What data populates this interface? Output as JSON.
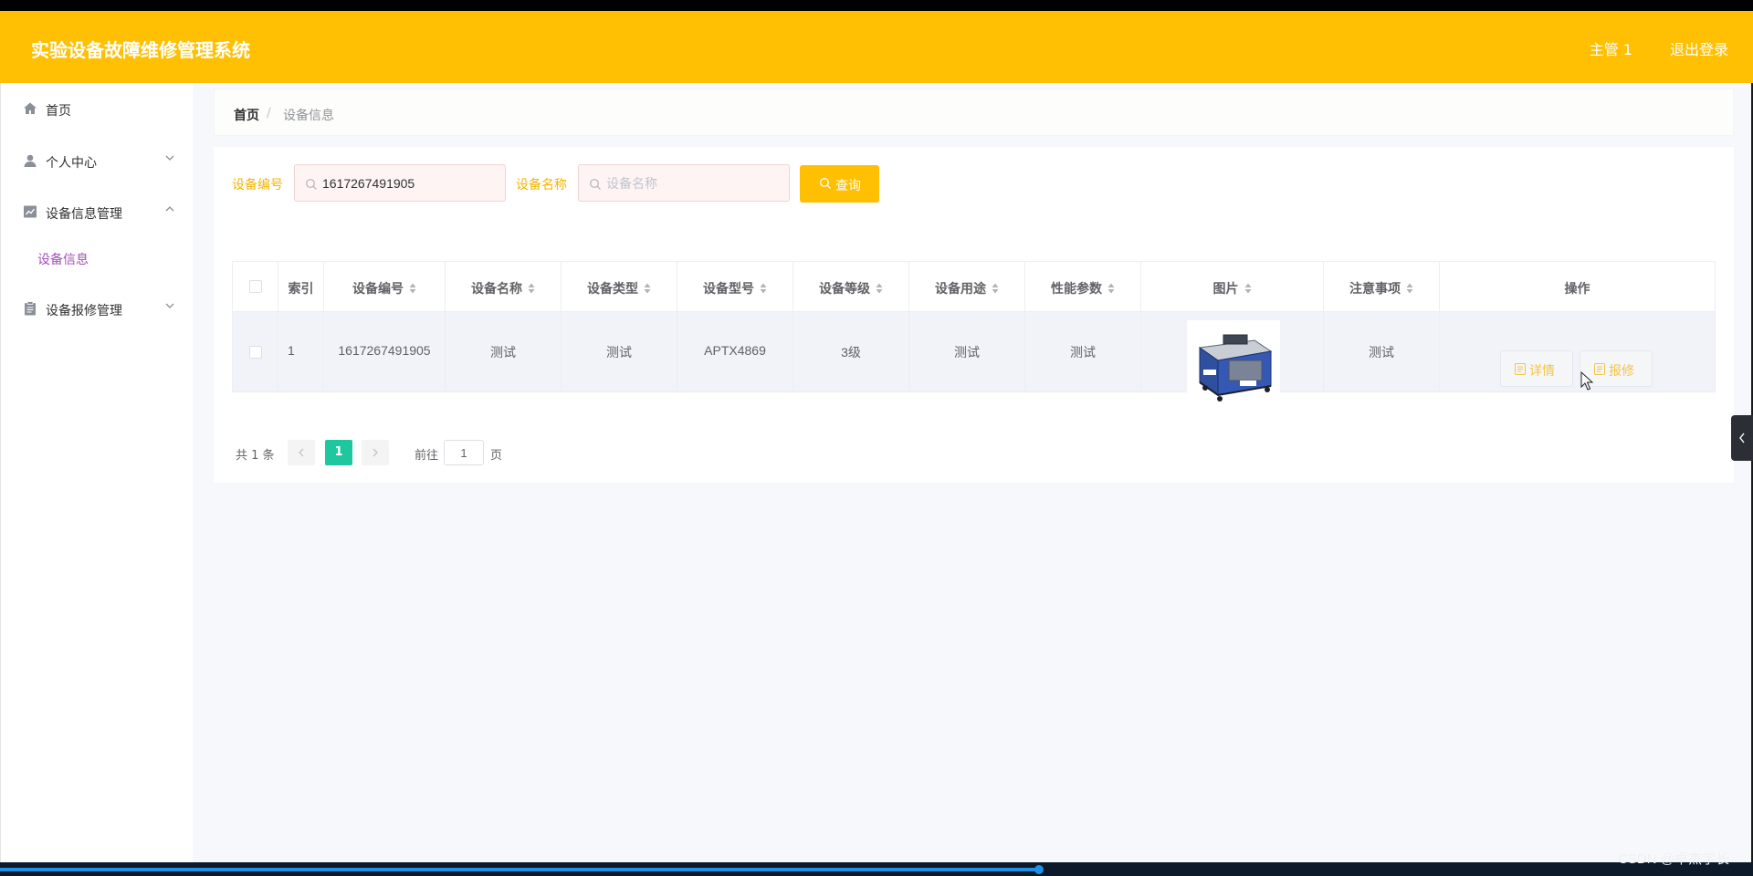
{
  "header": {
    "title": "实验设备故障维修管理系统",
    "user": "主管 1",
    "logout": "退出登录",
    "bg_color": "#ffc004"
  },
  "sidebar": {
    "items": [
      {
        "label": "首页",
        "icon": "home-icon"
      },
      {
        "label": "个人中心",
        "icon": "user-icon",
        "arrow": "chevron-down-icon"
      },
      {
        "label": "设备信息管理",
        "icon": "chart-icon",
        "arrow": "chevron-up-icon"
      },
      {
        "label": "设备信息",
        "icon": ""
      },
      {
        "label": "设备报修管理",
        "icon": "clipboard-icon",
        "arrow": "chevron-down-icon"
      }
    ],
    "active_color": "#a04fb8"
  },
  "breadcrumb": {
    "home": "首页",
    "separator": "/",
    "current": "设备信息"
  },
  "search": {
    "code_label": "设备编号",
    "code_value": "1617267491905",
    "code_placeholder": "设备编号",
    "name_label": "设备名称",
    "name_value": "",
    "name_placeholder": "设备名称",
    "query_label": "查询",
    "label_color": "#f3b400"
  },
  "table": {
    "columns": [
      "索引",
      "设备编号",
      "设备名称",
      "设备类型",
      "设备型号",
      "设备等级",
      "设备用途",
      "性能参数",
      "图片",
      "注意事项",
      "操作"
    ],
    "rows": [
      {
        "index": "1",
        "code": "1617267491905",
        "name": "测试",
        "type": "测试",
        "model": "APTX4869",
        "level": "3级",
        "usage": "测试",
        "params": "测试",
        "image": "equipment-photo",
        "notes": "测试",
        "actions": [
          "详情",
          "报修"
        ]
      }
    ]
  },
  "pagination": {
    "total": "共 1 条",
    "current_page": "1",
    "goto_label": "前往",
    "goto_value": "1",
    "page_suffix": "页",
    "active_color": "#1ec79e"
  },
  "watermark": "CSDN @卓杰学长"
}
